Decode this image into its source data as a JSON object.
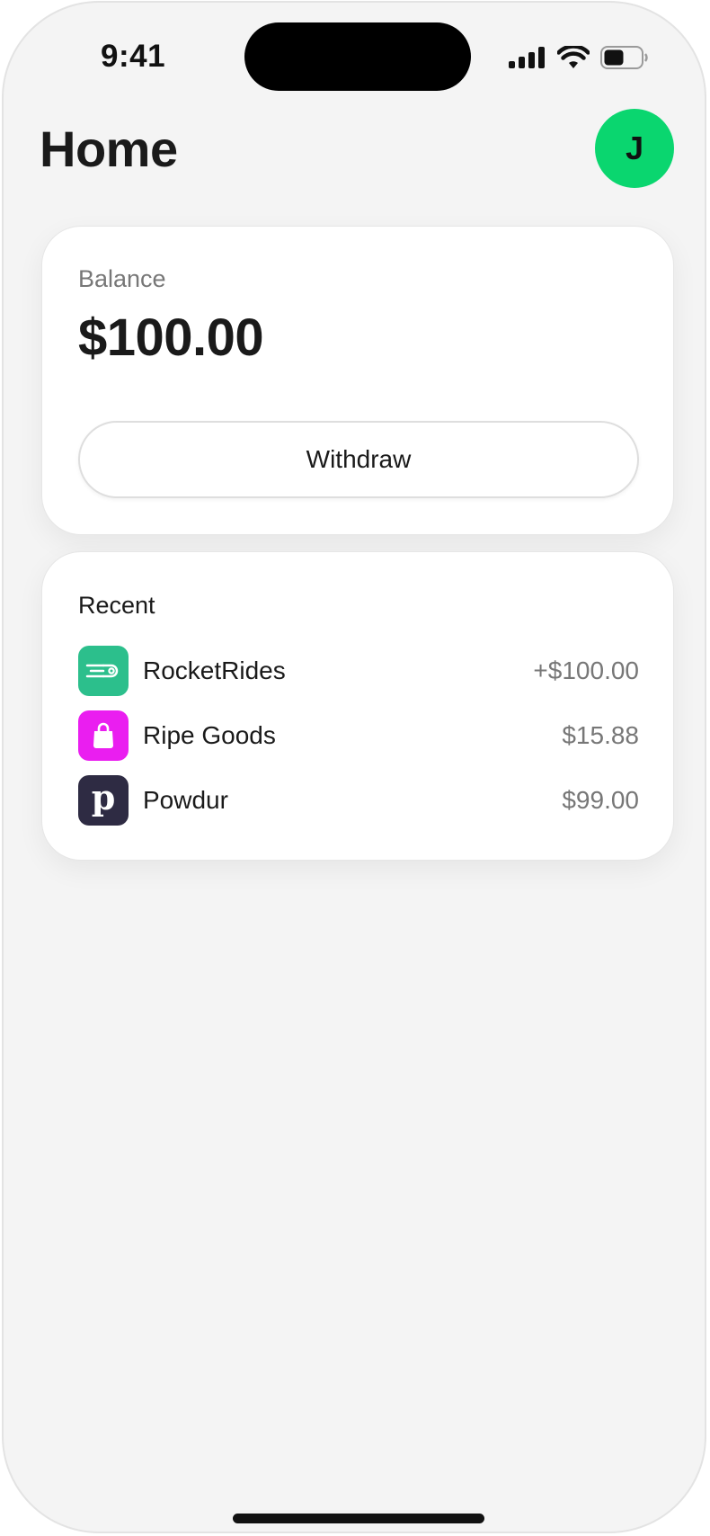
{
  "status_bar": {
    "time": "9:41"
  },
  "header": {
    "title": "Home",
    "avatar_initial": "J",
    "avatar_color": "#0ad66f"
  },
  "balance": {
    "label": "Balance",
    "amount": "$100.00",
    "withdraw_label": "Withdraw"
  },
  "recent": {
    "title": "Recent",
    "transactions": [
      {
        "name": "RocketRides",
        "amount": "+$100.00",
        "icon": "rocket-speed-icon",
        "icon_color": "#2cbf8c"
      },
      {
        "name": "Ripe Goods",
        "amount": "$15.88",
        "icon": "shopping-bag-icon",
        "icon_color": "#ea1ef0"
      },
      {
        "name": "Powdur",
        "amount": "$99.00",
        "icon": "powdur-logo-icon",
        "icon_color": "#2e2b43"
      }
    ]
  }
}
